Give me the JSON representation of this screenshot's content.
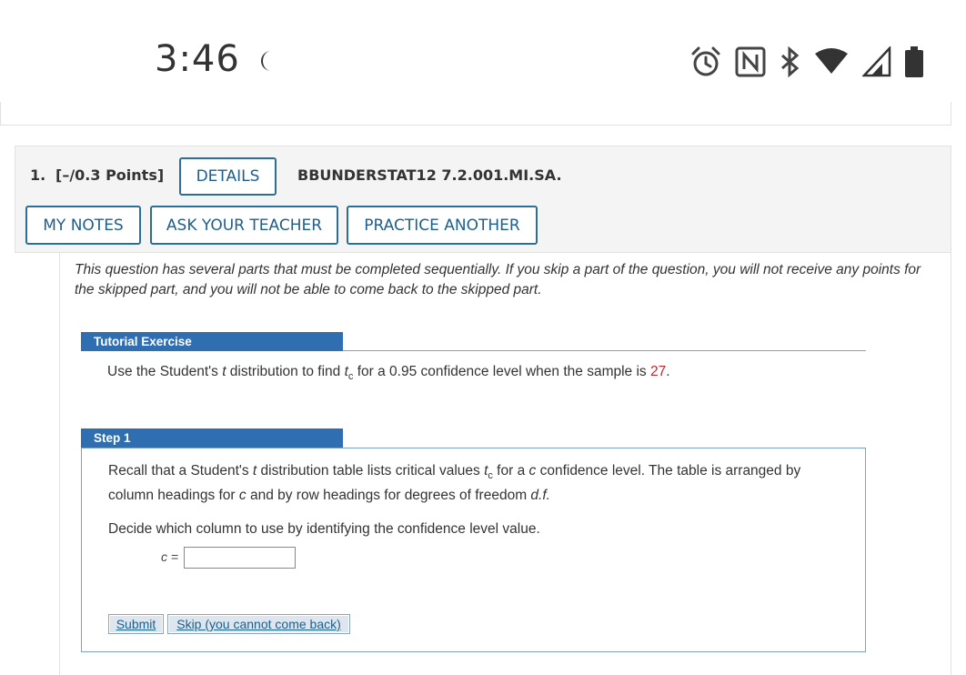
{
  "status_bar": {
    "time": "3:46",
    "icons": [
      "moon-icon",
      "alarm-icon",
      "nfc-icon",
      "bluetooth-icon",
      "wifi-icon",
      "signal-icon",
      "battery-icon"
    ]
  },
  "question": {
    "number": "1.",
    "points": "[–/0.3 Points]",
    "details_label": "DETAILS",
    "reference": "BBUNDERSTAT12 7.2.001.MI.SA.",
    "my_notes_label": "MY NOTES",
    "ask_teacher_label": "ASK YOUR TEACHER",
    "practice_label": "PRACTICE ANOTHER"
  },
  "intro": "This question has several parts that must be completed sequentially. If you skip a part of the question, you will not receive any points for the skipped part, and you will not be able to come back to the skipped part.",
  "tutorial": {
    "tab_label": "Tutorial Exercise",
    "text_before": "Use the Student's ",
    "t_var": "t",
    "text_mid": " distribution to find ",
    "tc_var": "t",
    "tc_sub": "c",
    "text_after": " for a 0.95 confidence level when the sample is ",
    "sample_value": "27",
    "period": "."
  },
  "step1": {
    "tab_label": "Step 1",
    "p1_a": "Recall that a Student's ",
    "p1_t": "t",
    "p1_b": " distribution table lists critical values ",
    "p1_tc": "t",
    "p1_tc_sub": "c",
    "p1_c": " for a ",
    "p1_cvar": "c",
    "p1_d": " confidence level. The table is arranged by column headings for ",
    "p1_cvar2": "c",
    "p1_e": " and by row headings for degrees of freedom ",
    "p1_df": "d.f.",
    "p2": "Decide which column to use by identifying the confidence level value.",
    "c_label": "c =",
    "c_value": "",
    "submit_label": "Submit",
    "skip_label": "Skip (you cannot come back)"
  },
  "colors": {
    "accent": "#2f6fb1",
    "button_border": "#2b6e97",
    "highlight_red": "#c0272d"
  }
}
